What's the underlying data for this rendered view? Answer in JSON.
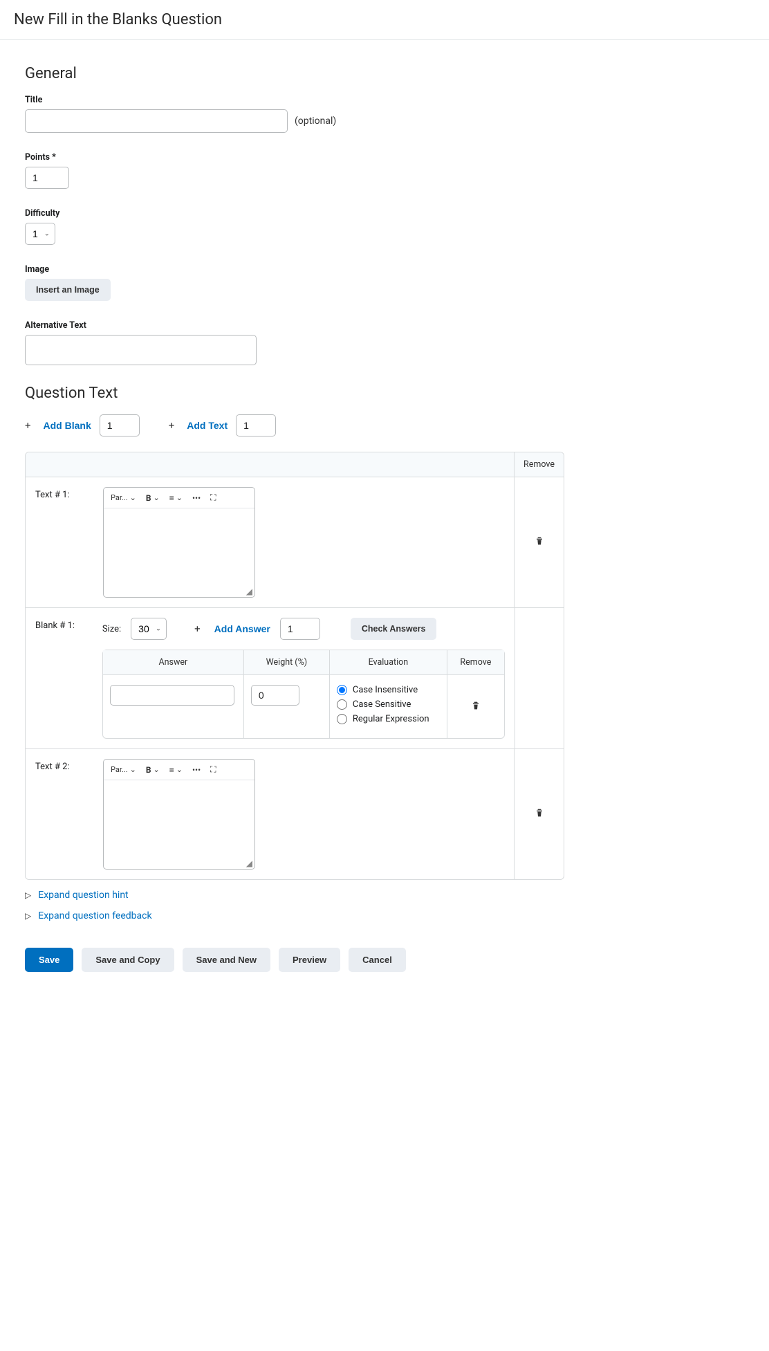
{
  "header": {
    "title": "New Fill in the Blanks Question"
  },
  "general": {
    "heading": "General",
    "title_label": "Title",
    "title_value": "",
    "optional": "(optional)",
    "points_label": "Points *",
    "points_value": "1",
    "difficulty_label": "Difficulty",
    "difficulty_value": "1",
    "image_label": "Image",
    "insert_image": "Insert an Image",
    "alt_label": "Alternative Text",
    "alt_value": ""
  },
  "question": {
    "heading": "Question Text",
    "add_blank": "Add Blank",
    "blank_count": "1",
    "add_text": "Add Text",
    "text_count": "1",
    "remove_head": "Remove",
    "rows": {
      "text1_label": "Text # 1:",
      "blank1_label": "Blank # 1:",
      "text2_label": "Text # 2:"
    },
    "rte": {
      "para": "Par...",
      "bold": "B",
      "more": "•••"
    },
    "blank": {
      "size_label": "Size:",
      "size_value": "30",
      "add_answer": "Add Answer",
      "answer_count": "1",
      "check_answers": "Check Answers",
      "headers": {
        "answer": "Answer",
        "weight": "Weight (%)",
        "evaluation": "Evaluation",
        "remove": "Remove"
      },
      "answer_value": "",
      "weight_value": "0",
      "eval_options": {
        "ci": "Case Insensitive",
        "cs": "Case Sensitive",
        "re": "Regular Expression"
      }
    }
  },
  "expand": {
    "hint": "Expand question hint",
    "feedback": "Expand question feedback"
  },
  "footer": {
    "save": "Save",
    "save_copy": "Save and Copy",
    "save_new": "Save and New",
    "preview": "Preview",
    "cancel": "Cancel"
  }
}
